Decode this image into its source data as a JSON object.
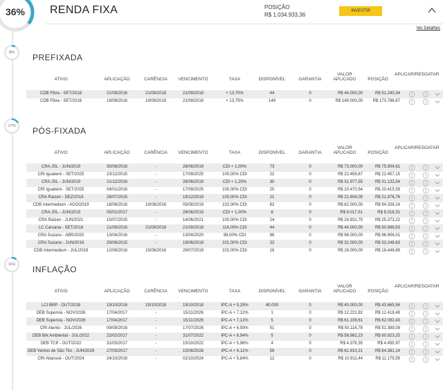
{
  "header": {
    "progress": "36%",
    "progress_fraction": 0.36,
    "title": "RENDA FIXA",
    "position_label": "POSIÇÃO",
    "position_value": "R$ 1.034.933,36",
    "invest_label": "INVESTIR",
    "details_label": "Ver Detalhes"
  },
  "columns": {
    "ativo": "ATIVO",
    "aplicacao": "APLICAÇÃO",
    "carencia": "CARÊNCIA",
    "vencimento": "VENCIMENTO",
    "taxa": "TAXA",
    "disponivel": "DISPONÍVEL",
    "garantia": "GARANTIA",
    "valor_aplicado": "VALOR APLICADO",
    "posicao": "POSIÇÃO",
    "acoes": "APLICAR/RESGATAR"
  },
  "colors": {
    "accent": "#3aa6c9",
    "button": "#f5c518",
    "ring_track": "#e4e4e4"
  },
  "sections": [
    {
      "title": "PREFIXADA",
      "percent": "8%",
      "fraction": 0.08,
      "rows": [
        [
          "CDB Fibra - SET/2018",
          "21/09/2016",
          "21/09/2018",
          "21/09/2018",
          "+ 13,70%",
          "44",
          "0",
          "R$ 44.000,00",
          "R$ 51.240,34"
        ],
        [
          "CDB Fibra - SET/2018",
          "19/09/2016",
          "19/09/2018",
          "21/09/2018",
          "+ 13,75%",
          "149",
          "0",
          "R$ 149.000,00",
          "R$ 173.786,67"
        ]
      ]
    },
    {
      "title": "PÓS-FIXADA",
      "percent": "17%",
      "fraction": 0.17,
      "rows": [
        [
          "CRA JSL - JUN/2019",
          "30/06/2016",
          "-",
          "28/06/2019",
          "CDI + 1,00%",
          "73",
          "0",
          "R$ 73.000,00",
          "R$ 75.904,61"
        ],
        [
          "CRI Iguatemi - SET/2025",
          "23/12/2015",
          "-",
          "17/09/2025",
          "100,00% CDI",
          "22",
          "0",
          "R$ 22.459,67",
          "R$ 22.457,15"
        ],
        [
          "CRA JSL - JUN/2019",
          "21/12/2016",
          "-",
          "28/06/2019",
          "CDI + 1,20%",
          "30",
          "0",
          "R$ 31.977,55",
          "R$ 31.132,54"
        ],
        [
          "CRI Iguatemi - SET/2025",
          "04/01/2016",
          "-",
          "17/09/2025",
          "100,00% CDI",
          "20",
          "0",
          "R$ 20.470,54",
          "R$ 20.415,59"
        ],
        [
          "CRA Raizen - DEZ/2019",
          "28/07/2015",
          "-",
          "18/12/2019",
          "100,00% CDI",
          "21",
          "0",
          "R$ 21.606,05",
          "R$ 21.976,76"
        ],
        [
          "CDB Intermedium - AGO/2019",
          "18/08/2016",
          "19/08/2016",
          "05/08/2019",
          "102,00% CDI",
          "82",
          "0",
          "R$ 82.000,00",
          "R$ 94.338,24"
        ],
        [
          "CRA JSL - JUN/2019",
          "05/01/2017",
          "-",
          "28/06/2019",
          "CDI + 1,00%",
          "8",
          "0",
          "R$ 8.017,51",
          "R$ 8.318,31"
        ],
        [
          "CRA Raizen - JUN/2021",
          "15/07/2015",
          "-",
          "14/06/2021",
          "100,00% CDI",
          "24",
          "0",
          "R$ 24.831,75",
          "R$ 25.373,22"
        ],
        [
          "LC Caruana - SET/2018",
          "21/09/2016",
          "21/09/2018",
          "21/09/2018",
          "116,00% CDI",
          "44",
          "0",
          "R$ 44.000,00",
          "R$ 50.886,53"
        ],
        [
          "CRA Suzano - ABR/2020",
          "13/04/2016",
          "-",
          "13/04/2020",
          "98,00% CDI",
          "96",
          "0",
          "R$ 96.000,00",
          "R$ 96.906,01"
        ],
        [
          "CRA Suzano - JUN/2019",
          "29/06/2015",
          "-",
          "19/06/2019",
          "101,00% CDI",
          "32",
          "0",
          "R$ 32.000,00",
          "R$ 33.248,63"
        ],
        [
          "CDB Intermedium - JUL/2019",
          "12/08/2016",
          "15/08/2016",
          "29/07/2019",
          "102,00% CDI",
          "16",
          "0",
          "R$ 16.000,00",
          "R$ 18.446,89"
        ]
      ]
    },
    {
      "title": "INFLAÇÃO",
      "percent": "11%",
      "fraction": 0.11,
      "rows": [
        [
          "LCI BRP - OUT/2018",
          "19/10/2016",
          "19/10/2018",
          "19/10/2018",
          "IPC-A + 5,25%",
          "40.000",
          "0",
          "R$ 40.000,00",
          "R$ 43.665,94"
        ],
        [
          "DEB Supervia - NOV/2026",
          "17/04/2017",
          "-",
          "15/11/2026",
          "IPC-A + 7,12%",
          "1",
          "0",
          "R$ 12.221,92",
          "R$ 12.418,49"
        ],
        [
          "DEB Supervia - NOV/2026",
          "17/04/2017",
          "-",
          "15/11/2026",
          "IPC-A + 7,12%",
          "5",
          "0",
          "R$ 61.109,61",
          "R$ 62.092,43"
        ],
        [
          "CRI Atento - JUL/2026",
          "09/09/2016",
          "-",
          "17/07/2026",
          "IPC-A + 6,93%",
          "51",
          "0",
          "R$ 50.116,78",
          "R$ 51.389,09"
        ],
        [
          "DEB Brk Ambiental - JUL/2022",
          "22/02/2017",
          "-",
          "31/07/2022",
          "IPC-A + 6,94%",
          "5",
          "0",
          "R$ 58.982,23",
          "R$ 60.923,25"
        ],
        [
          "DEB TCP - OUT/2022",
          "31/03/2017",
          "-",
          "15/10/2022",
          "IPC-A + 5,96%",
          "4",
          "0",
          "R$ 4.379,35",
          "R$ 4.455,97"
        ],
        [
          "DEB Ventos de São Tito - JUN/2028",
          "27/03/2017",
          "-",
          "15/06/2028",
          "IPC-A + 6,11%",
          "56",
          "0",
          "R$ 61.810,21",
          "R$ 64.381,14"
        ],
        [
          "CRI Alianscé - OUT/2024",
          "24/10/2016",
          "-",
          "02/10/2024",
          "IPC-A + 5,84%",
          "12",
          "0",
          "R$ 10.911,44",
          "R$ 11.175,59"
        ]
      ]
    }
  ]
}
